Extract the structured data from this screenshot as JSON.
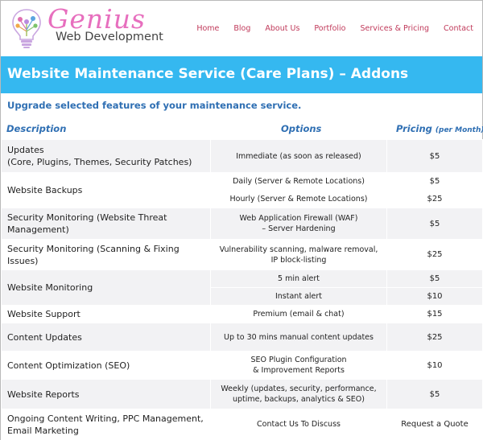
{
  "header": {
    "brand_main": "Genius",
    "brand_sub": "Web Development",
    "nav": [
      "Home",
      "Blog",
      "About Us",
      "Portfolio",
      "Services & Pricing",
      "Contact"
    ]
  },
  "banner": {
    "title": "Website Maintenance Service (Care Plans) – Addons"
  },
  "subtitle": "Upgrade selected features of your maintenance service.",
  "table": {
    "col_description": "Description",
    "col_options": "Options",
    "col_pricing": "Pricing",
    "col_pricing_note": "(per Month)",
    "rows": [
      {
        "description": [
          "Updates",
          "(Core, Plugins, Themes, Security Patches)"
        ],
        "options": [
          [
            "Immediate (as soon as released)"
          ]
        ],
        "prices": [
          "$5"
        ]
      },
      {
        "description": [
          "Website Backups"
        ],
        "options": [
          [
            "Daily (Server & Remote Locations)"
          ],
          [
            "Hourly (Server & Remote Locations)"
          ]
        ],
        "prices": [
          "$5",
          "$25"
        ]
      },
      {
        "description": [
          "Security Monitoring (Website Threat",
          "Management)"
        ],
        "options": [
          [
            "Web Application Firewall (WAF)",
            "– Server Hardening"
          ]
        ],
        "prices": [
          "$5"
        ]
      },
      {
        "description": [
          "Security Monitoring (Scanning & Fixing Issues)"
        ],
        "options": [
          [
            "Vulnerability scanning, malware removal,",
            "IP block-listing"
          ]
        ],
        "prices": [
          "$25"
        ]
      },
      {
        "description": [
          "Website Monitoring"
        ],
        "options": [
          [
            "5 min alert"
          ],
          [
            "Instant alert"
          ]
        ],
        "prices": [
          "$5",
          "$10"
        ]
      },
      {
        "description": [
          "Website Support"
        ],
        "options": [
          [
            "Premium (email & chat)"
          ]
        ],
        "prices": [
          "$15"
        ]
      },
      {
        "description": [
          "Content Updates"
        ],
        "options": [
          [
            "Up to 30 mins manual content updates"
          ]
        ],
        "prices": [
          "$25"
        ]
      },
      {
        "description": [
          "Content Optimization (SEO)"
        ],
        "options": [
          [
            "SEO Plugin Configuration",
            "& Improvement Reports"
          ]
        ],
        "prices": [
          "$10"
        ]
      },
      {
        "description": [
          "Website Reports"
        ],
        "options": [
          [
            "Weekly (updates, security, performance,",
            "uptime, backups, analytics & SEO)"
          ]
        ],
        "prices": [
          "$5"
        ]
      },
      {
        "description": [
          "Ongoing Content Writing, PPC Management,",
          "Email Marketing"
        ],
        "options": [
          [
            "Contact Us To Discuss"
          ]
        ],
        "prices": [
          "Request a Quote"
        ]
      }
    ]
  },
  "colors": {
    "banner": "#35b8f0",
    "brand_pink": "#e76fbe",
    "nav_link": "#c0395a",
    "heading_blue": "#2f6fb3",
    "row_shade": "#f2f2f4"
  }
}
